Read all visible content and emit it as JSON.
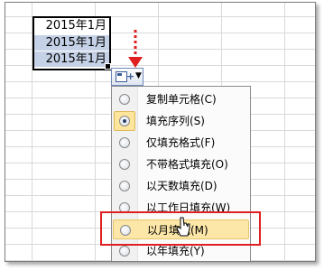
{
  "cells": [
    "2015年1月",
    "2015年1月",
    "2015年1月"
  ],
  "menu": {
    "items": [
      {
        "label": "复制单元格(C)",
        "checked": false
      },
      {
        "label": "填充序列(S)",
        "checked": true
      },
      {
        "label": "仅填充格式(F)",
        "checked": false
      },
      {
        "label": "不带格式填充(O)",
        "checked": false
      },
      {
        "label": "以天数填充(D)",
        "checked": false
      },
      {
        "label": "以工作日填充(W)",
        "checked": false
      },
      {
        "label": "以月填充(M)",
        "checked": false,
        "hovered": true
      },
      {
        "label": "以年填充(Y)",
        "checked": false
      }
    ]
  },
  "colors": {
    "highlight_box": "#e02020",
    "selection_fill": "#c5d1e6",
    "hover_fill": "#fde7a8"
  }
}
